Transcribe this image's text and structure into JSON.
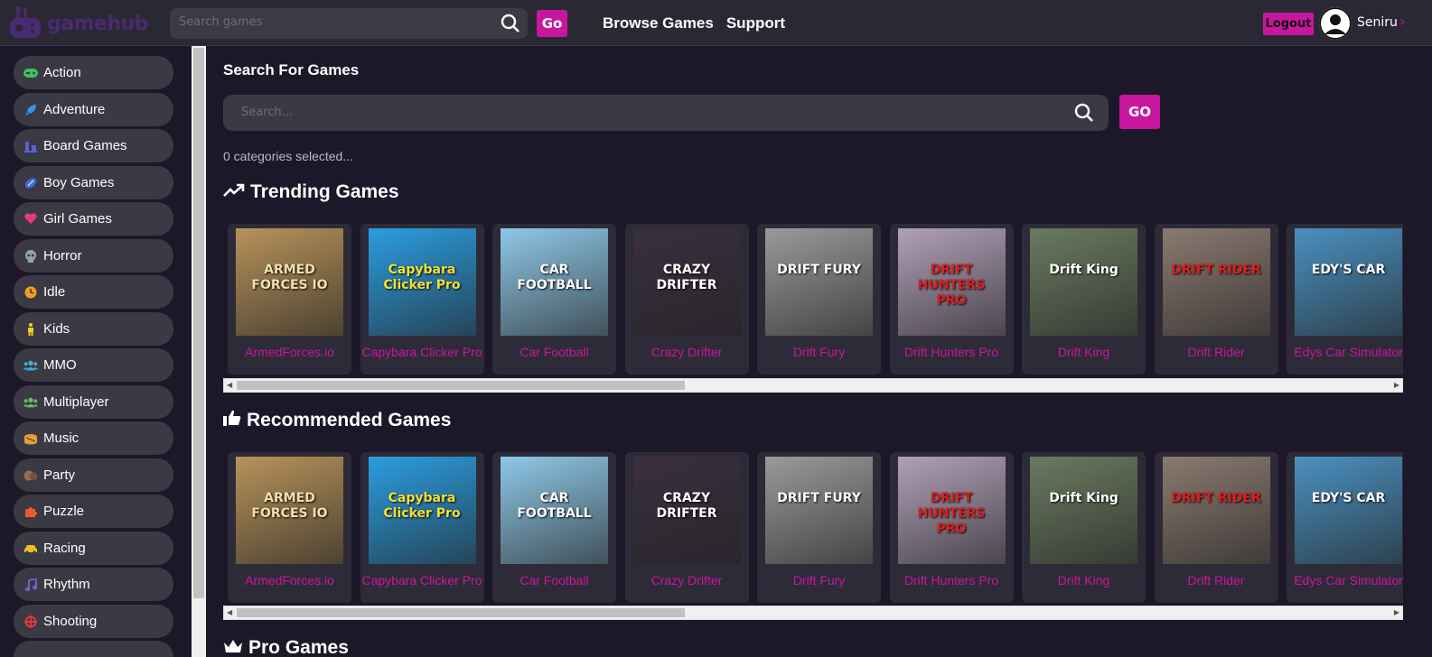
{
  "header": {
    "logo_text": "gamehub",
    "search_placeholder": "Search games",
    "go_label": "Go",
    "nav": [
      "Browse Games",
      "Support"
    ],
    "logout_label": "Logout",
    "username": "Seniru"
  },
  "sidebar": {
    "items": [
      {
        "label": "Action",
        "icon": "gamepad-icon",
        "color": "#3fbf5f"
      },
      {
        "label": "Adventure",
        "icon": "rocket-icon",
        "color": "#3a8ef0"
      },
      {
        "label": "Board Games",
        "icon": "chess-icon",
        "color": "#5b5fd6"
      },
      {
        "label": "Boy Games",
        "icon": "football-icon",
        "color": "#3a6fd8"
      },
      {
        "label": "Girl Games",
        "icon": "heart-icon",
        "color": "#e83a7a"
      },
      {
        "label": "Horror",
        "icon": "skull-icon",
        "color": "#8fa3b5"
      },
      {
        "label": "Idle",
        "icon": "clock-icon",
        "color": "#f0a020"
      },
      {
        "label": "Kids",
        "icon": "child-icon",
        "color": "#f0d020"
      },
      {
        "label": "MMO",
        "icon": "users-icon",
        "color": "#3ab0d0"
      },
      {
        "label": "Multiplayer",
        "icon": "people-icon",
        "color": "#5fc05f"
      },
      {
        "label": "Music",
        "icon": "drum-icon",
        "color": "#e8a030"
      },
      {
        "label": "Party",
        "icon": "cookie-icon",
        "color": "#9a6a50"
      },
      {
        "label": "Puzzle",
        "icon": "puzzle-icon",
        "color": "#e85a30"
      },
      {
        "label": "Racing",
        "icon": "car-icon",
        "color": "#f0c020"
      },
      {
        "label": "Rhythm",
        "icon": "music-note-icon",
        "color": "#7a5ad0"
      },
      {
        "label": "Shooting",
        "icon": "crosshair-icon",
        "color": "#e03a3a"
      }
    ]
  },
  "main": {
    "search_title": "Search For Games",
    "search_placeholder": "Search...",
    "go_label": "GO",
    "categories_selected": "0 categories selected...",
    "sections": [
      {
        "title": "Trending Games",
        "icon": "trending-up-icon"
      },
      {
        "title": "Recommended Games",
        "icon": "thumbs-up-icon"
      },
      {
        "title": "Pro Games",
        "icon": "crown-icon"
      }
    ],
    "games": [
      {
        "title": "ArmedForces.io",
        "art": "ARMED FORCES IO",
        "bg": "#b8925a",
        "fg": "#f0e0b0"
      },
      {
        "title": "Capybara Clicker Pro",
        "art": "Capybara Clicker Pro",
        "bg": "#2b9de0",
        "fg": "#f5e030"
      },
      {
        "title": "Car Football",
        "art": "CAR FOOTBALL",
        "bg": "#8fc8e8",
        "fg": "#ffffff"
      },
      {
        "title": "Crazy Drifter",
        "art": "CRAZY DRIFTER",
        "bg": "#3a2f3f",
        "fg": "#ffffff"
      },
      {
        "title": "Drift Fury",
        "art": "DRIFT FURY",
        "bg": "#9a9a9a",
        "fg": "#ffffff"
      },
      {
        "title": "Drift Hunters Pro",
        "art": "DRIFT HUNTERS PRO",
        "bg": "#b0a0b8",
        "fg": "#d82020"
      },
      {
        "title": "Drift King",
        "art": "Drift King",
        "bg": "#6a7a60",
        "fg": "#ffffff"
      },
      {
        "title": "Drift Rider",
        "art": "DRIFT RIDER",
        "bg": "#8a7a70",
        "fg": "#d82020"
      },
      {
        "title": "Edys Car Simulator",
        "art": "EDY'S CAR",
        "bg": "#4a90c0",
        "fg": "#ffffff"
      }
    ]
  }
}
